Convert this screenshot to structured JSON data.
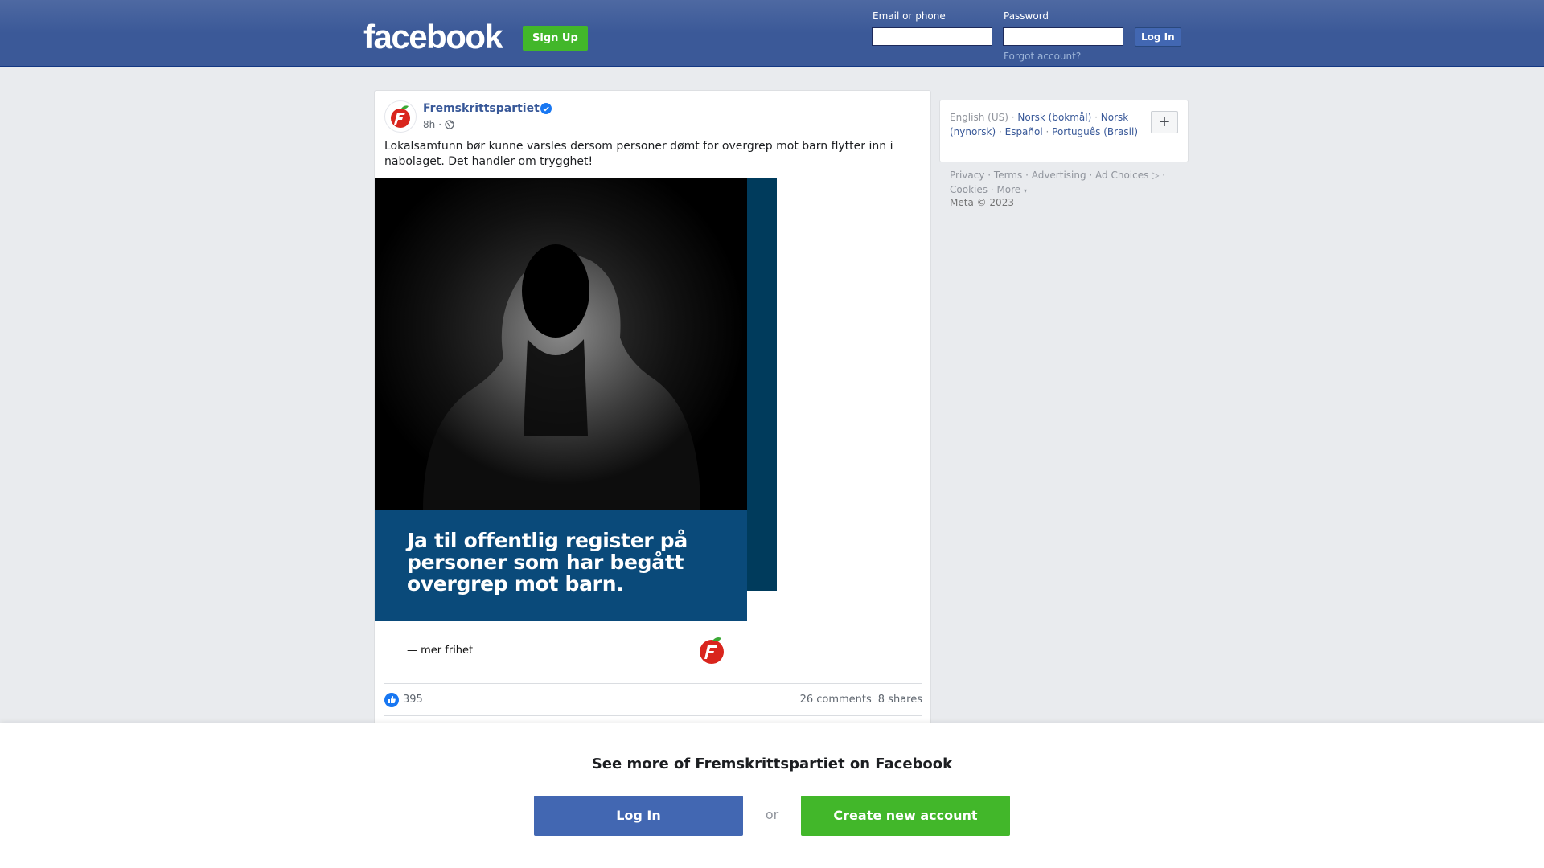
{
  "header": {
    "logo": "facebook",
    "signup_label": "Sign Up",
    "email_label": "Email or phone",
    "password_label": "Password",
    "login_label": "Log In",
    "forgot_label": "Forgot account?"
  },
  "post": {
    "author": "Fremskrittspartiet",
    "time": "8h",
    "separator": "·",
    "text": "Lokalsamfunn bør kunne varsles dersom personer dømt for overgrep mot barn flytter inn i nabolaget. Det handler om trygghet!",
    "image_banner_text": "Ja til offentlig register på personer som har begått overgrep mot barn.",
    "image_slogan": "— mer frihet",
    "reactions": "395",
    "comments": "26 comments",
    "shares": "8 shares"
  },
  "sidebar": {
    "current_language": "English (US)",
    "languages": [
      "Norsk (bokmål)",
      "Norsk (nynorsk)",
      "Español",
      "Português (Brasil)"
    ],
    "plus_label": "+",
    "footer_links": [
      "Privacy",
      "Terms",
      "Advertising",
      "Ad Choices",
      "Cookies",
      "More"
    ],
    "copyright": "Meta © 2023"
  },
  "overlay": {
    "title": "See more of Fremskrittspartiet on Facebook",
    "login_label": "Log In",
    "or_label": "or",
    "create_label": "Create new account"
  },
  "colors": {
    "brand_blue": "#3b5998",
    "button_blue": "#4267b2",
    "signup_green": "#42b72a",
    "link_blue": "#385898",
    "banner_blue": "#0a4a7a",
    "party_red": "#d9251d"
  },
  "icons": [
    "verified-badge-icon",
    "globe-icon",
    "like-icon",
    "ad-choices-icon",
    "party-logo-icon"
  ]
}
